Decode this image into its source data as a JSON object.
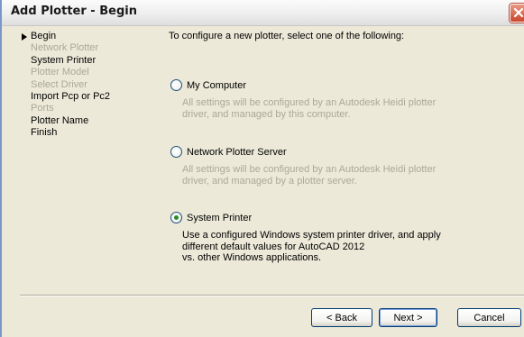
{
  "window": {
    "title": "Add Plotter - Begin"
  },
  "steps": [
    {
      "label": "Begin",
      "state": "current"
    },
    {
      "label": "Network Plotter",
      "state": "disabled"
    },
    {
      "label": "System Printer",
      "state": "enabled"
    },
    {
      "label": "Plotter Model",
      "state": "disabled"
    },
    {
      "label": "Select Driver",
      "state": "disabled"
    },
    {
      "label": "Import Pcp or Pc2",
      "state": "enabled"
    },
    {
      "label": "Ports",
      "state": "disabled"
    },
    {
      "label": "Plotter Name",
      "state": "enabled"
    },
    {
      "label": "Finish",
      "state": "enabled"
    }
  ],
  "main": {
    "prompt": "To configure a new plotter, select one of the following:",
    "options": [
      {
        "label": "My Computer",
        "selected": false,
        "desc_lines": [
          "All settings will be configured by an Autodesk Heidi plotter",
          "driver, and managed by this computer."
        ]
      },
      {
        "label": "Network Plotter Server",
        "selected": false,
        "desc_lines": [
          "All settings will be configured by an Autodesk Heidi plotter",
          "driver, and managed by a plotter server."
        ]
      },
      {
        "label": "System Printer",
        "selected": true,
        "desc_lines": [
          "Use a configured Windows system printer driver, and apply",
          "different default values for AutoCAD 2012",
          "vs. other Windows applications."
        ]
      }
    ]
  },
  "buttons": {
    "back": "< Back",
    "next": "Next >",
    "cancel": "Cancel"
  },
  "icons": {
    "close": "close-icon",
    "current_step": "current-step-arrow-icon"
  },
  "colors": {
    "disabled_text": "#aca899",
    "selected_radio": "#2a8a2a",
    "close_button": "#c9462c"
  }
}
